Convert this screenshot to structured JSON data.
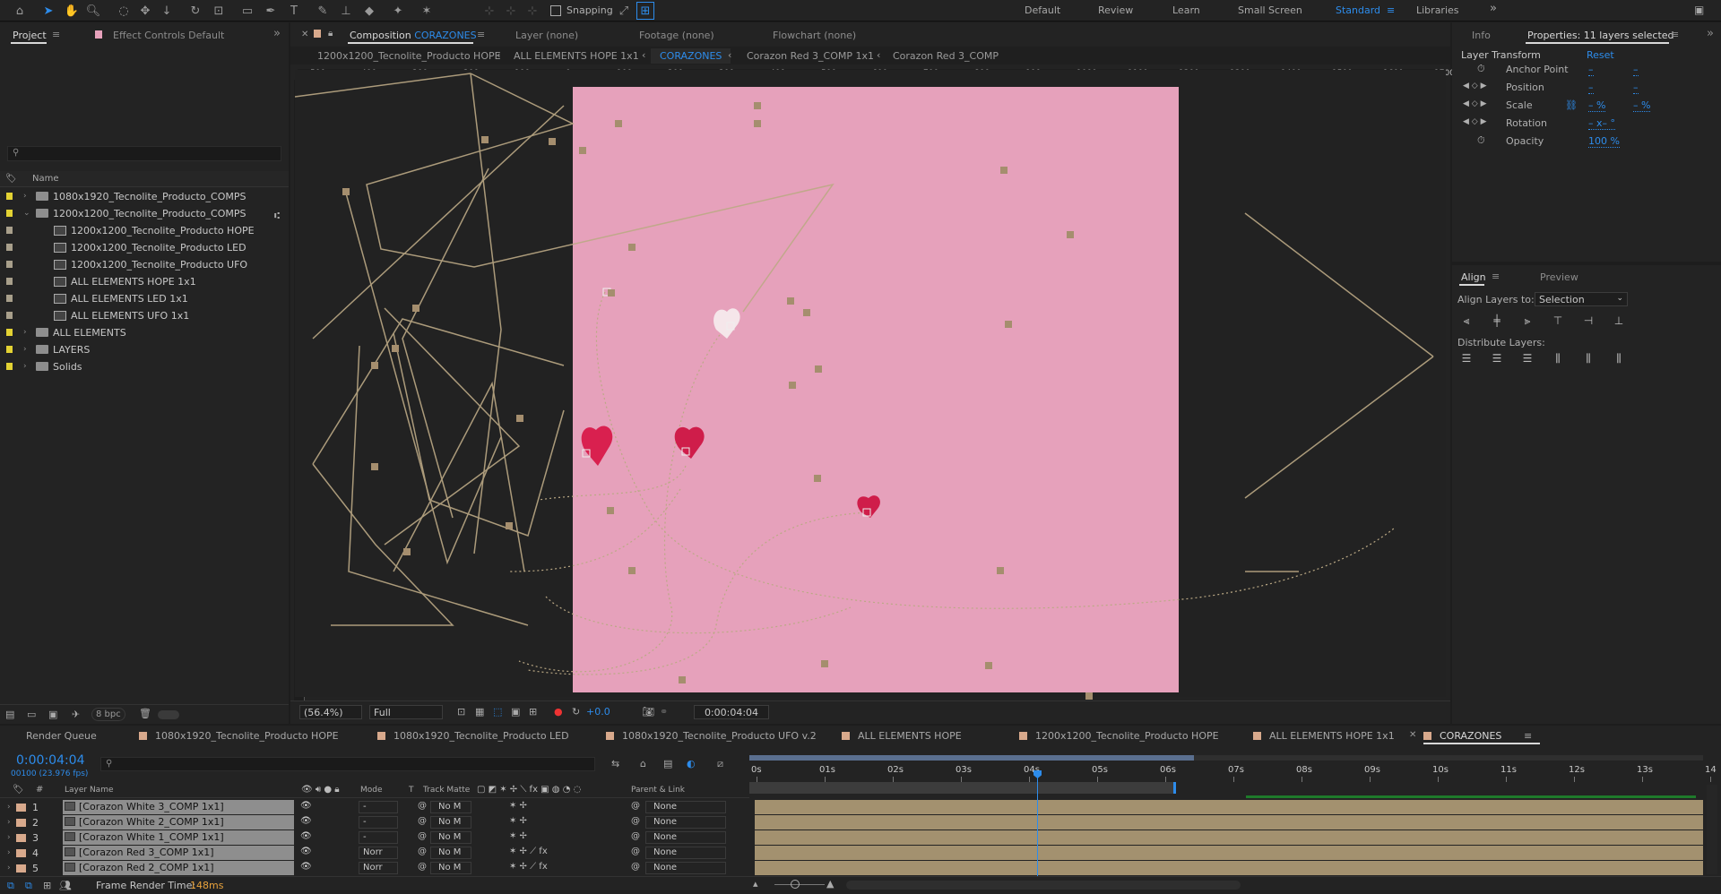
{
  "toolbar": {
    "snapping_label": "Snapping",
    "workspaces": [
      "Default",
      "Review",
      "Learn",
      "Small Screen",
      "Standard",
      "Libraries"
    ],
    "active_workspace": "Standard"
  },
  "project_panel": {
    "tab_project": "Project",
    "tab_effect_controls": "Effect Controls Default",
    "search_placeholder": "",
    "column_name": "Name",
    "items": [
      {
        "label": "1080x1920_Tecnolite_Producto_COMPS",
        "type": "folder",
        "indent": 0,
        "expanded": false,
        "color": "#e3d233"
      },
      {
        "label": "1200x1200_Tecnolite_Producto_COMPS",
        "type": "folder",
        "indent": 0,
        "expanded": true,
        "color": "#e3d233"
      },
      {
        "label": "1200x1200_Tecnolite_Producto HOPE",
        "type": "comp",
        "indent": 1,
        "color": "#a89f8b"
      },
      {
        "label": "1200x1200_Tecnolite_Producto LED",
        "type": "comp",
        "indent": 1,
        "color": "#a89f8b"
      },
      {
        "label": "1200x1200_Tecnolite_Producto UFO",
        "type": "comp",
        "indent": 1,
        "color": "#a89f8b"
      },
      {
        "label": "ALL ELEMENTS HOPE 1x1",
        "type": "comp",
        "indent": 1,
        "color": "#a89f8b"
      },
      {
        "label": "ALL ELEMENTS LED 1x1",
        "type": "comp",
        "indent": 1,
        "color": "#a89f8b"
      },
      {
        "label": "ALL ELEMENTS UFO 1x1",
        "type": "comp",
        "indent": 1,
        "color": "#a89f8b"
      },
      {
        "label": "ALL ELEMENTS",
        "type": "folder",
        "indent": 0,
        "expanded": false,
        "color": "#e3d233"
      },
      {
        "label": "LAYERS",
        "type": "folder",
        "indent": 0,
        "expanded": false,
        "color": "#e3d233"
      },
      {
        "label": "Solids",
        "type": "folder",
        "indent": 0,
        "expanded": false,
        "color": "#e3d233"
      }
    ],
    "bpc": "8 bpc"
  },
  "viewer": {
    "tab_composition_prefix": "Composition",
    "tab_composition_name": "CORAZONES",
    "tab_layer": "Layer (none)",
    "tab_footage": "Footage (none)",
    "tab_flowchart": "Flowchart (none)",
    "breadcrumbs": [
      "1200x1200_Tecnolite_Producto HOPE",
      "ALL ELEMENTS HOPE 1x1",
      "CORAZONES",
      "Corazon Red 3_COMP 1x1",
      "Corazon Red 3_COMP"
    ],
    "active_crumb": "CORAZONES",
    "ruler_top": [
      "500",
      "400",
      "300",
      "200",
      "100",
      "0",
      "100",
      "200",
      "300",
      "400",
      "500",
      "600",
      "700",
      "800",
      "900",
      "1000",
      "1100",
      "1200",
      "1300",
      "1400",
      "1500",
      "1600",
      "1700"
    ],
    "zoom": "(56.4%)",
    "resolution": "Full",
    "exposure": "+0.0",
    "timecode": "0:00:04:04"
  },
  "properties_panel": {
    "tab_info": "Info",
    "tab_properties": "Properties: 11 layers selected",
    "section": "Layer Transform",
    "reset": "Reset",
    "props": [
      {
        "name": "Anchor Point",
        "v1": "–",
        "v2": "–"
      },
      {
        "name": "Position",
        "v1": "–",
        "v2": "–"
      },
      {
        "name": "Scale",
        "v1": "– %",
        "v2": "– %"
      },
      {
        "name": "Rotation",
        "v1": "– x– °",
        "v2": ""
      },
      {
        "name": "Opacity",
        "v1": "100 %",
        "v2": ""
      }
    ]
  },
  "align_panel": {
    "tab_align": "Align",
    "tab_preview": "Preview",
    "align_to_label": "Align Layers to:",
    "align_to_value": "Selection",
    "distribute_label": "Distribute Layers:"
  },
  "timeline": {
    "tabs": [
      {
        "label": "Render Queue",
        "color": ""
      },
      {
        "label": "1080x1920_Tecnolite_Producto HOPE",
        "color": "#d8a98c"
      },
      {
        "label": "1080x1920_Tecnolite_Producto LED",
        "color": "#d8a98c"
      },
      {
        "label": "1080x1920_Tecnolite_Producto UFO v.2",
        "color": "#d8a98c"
      },
      {
        "label": "ALL ELEMENTS HOPE",
        "color": "#d8a98c"
      },
      {
        "label": "1200x1200_Tecnolite_Producto HOPE",
        "color": "#d8a98c"
      },
      {
        "label": "ALL ELEMENTS HOPE 1x1",
        "color": "#d8a98c"
      },
      {
        "label": "CORAZONES",
        "color": "#d8a98c"
      }
    ],
    "current_time": "0:00:04:04",
    "fps": "00100 (23.976 fps)",
    "col_layer_name": "Layer Name",
    "col_mode": "Mode",
    "col_t": "T",
    "col_track_matte": "Track Matte",
    "col_parent": "Parent & Link",
    "ruler": [
      "0s",
      "01s",
      "02s",
      "03s",
      "04s",
      "05s",
      "06s",
      "07s",
      "08s",
      "09s",
      "10s",
      "11s",
      "12s",
      "13s",
      "14"
    ],
    "layers": [
      {
        "num": "1",
        "name": "[Corazon White 3_COMP 1x1]",
        "mode": "-",
        "matte": "No M",
        "parent": "None",
        "color": "#d8a98c"
      },
      {
        "num": "2",
        "name": "[Corazon White 2_COMP 1x1]",
        "mode": "-",
        "matte": "No M",
        "parent": "None",
        "color": "#d8a98c"
      },
      {
        "num": "3",
        "name": "[Corazon White 1_COMP 1x1]",
        "mode": "-",
        "matte": "No M",
        "parent": "None",
        "color": "#d8a98c"
      },
      {
        "num": "4",
        "name": "[Corazon Red 3_COMP 1x1]",
        "mode": "Norr",
        "matte": "No M",
        "parent": "None",
        "color": "#d8a98c"
      },
      {
        "num": "5",
        "name": "[Corazon Red 2_COMP 1x1]",
        "mode": "Norr",
        "matte": "No M",
        "parent": "None",
        "color": "#d8a98c"
      }
    ],
    "frame_render_label": "Frame Render Time:",
    "frame_render_value": "148ms"
  }
}
